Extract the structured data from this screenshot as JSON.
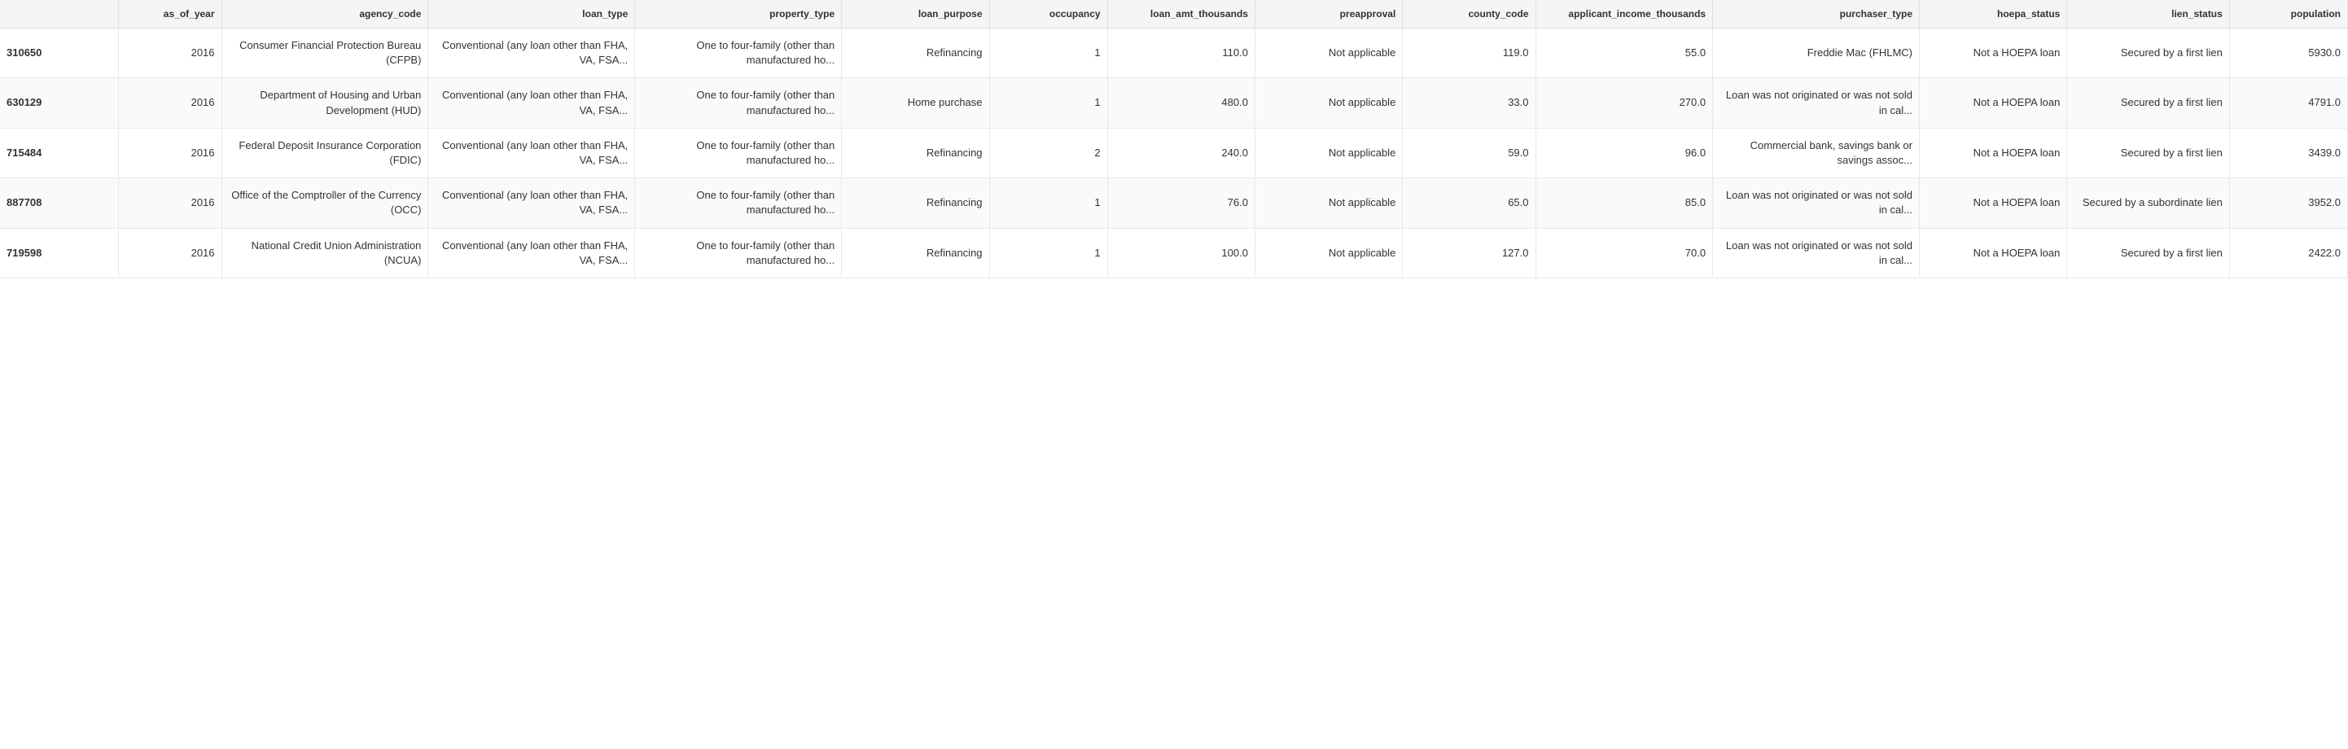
{
  "table": {
    "columns": [
      {
        "key": "id",
        "label": "",
        "class": "col-id"
      },
      {
        "key": "as_of_year",
        "label": "as_of_year",
        "class": "col-year"
      },
      {
        "key": "agency_code",
        "label": "agency_code",
        "class": "col-agency"
      },
      {
        "key": "loan_type",
        "label": "loan_type",
        "class": "col-loan-type"
      },
      {
        "key": "property_type",
        "label": "property_type",
        "class": "col-property"
      },
      {
        "key": "loan_purpose",
        "label": "loan_purpose",
        "class": "col-purpose"
      },
      {
        "key": "occupancy",
        "label": "occupancy",
        "class": "col-occupancy"
      },
      {
        "key": "loan_amt_thousands",
        "label": "loan_amt_thousands",
        "class": "col-amt"
      },
      {
        "key": "preapproval",
        "label": "preapproval",
        "class": "col-preapproval"
      },
      {
        "key": "county_code",
        "label": "county_code",
        "class": "col-county"
      },
      {
        "key": "applicant_income_thousands",
        "label": "applicant_income_thousands",
        "class": "col-income"
      },
      {
        "key": "purchaser_type",
        "label": "purchaser_type",
        "class": "col-purchaser"
      },
      {
        "key": "hoepa_status",
        "label": "hoepa_status",
        "class": "col-hoepa"
      },
      {
        "key": "lien_status",
        "label": "lien_status",
        "class": "col-lien"
      },
      {
        "key": "population",
        "label": "population",
        "class": "col-population"
      }
    ],
    "rows": [
      {
        "id": "310650",
        "as_of_year": "2016",
        "agency_code": "Consumer Financial Protection Bureau (CFPB)",
        "loan_type": "Conventional (any loan other than FHA, VA, FSA...",
        "property_type": "One to four-family (other than manufactured ho...",
        "loan_purpose": "Refinancing",
        "occupancy": "1",
        "loan_amt_thousands": "110.0",
        "preapproval": "Not applicable",
        "county_code": "119.0",
        "applicant_income_thousands": "55.0",
        "purchaser_type": "Freddie Mac (FHLMC)",
        "hoepa_status": "Not a HOEPA loan",
        "lien_status": "Secured by a first lien",
        "population": "5930.0"
      },
      {
        "id": "630129",
        "as_of_year": "2016",
        "agency_code": "Department of Housing and Urban Development (HUD)",
        "loan_type": "Conventional (any loan other than FHA, VA, FSA...",
        "property_type": "One to four-family (other than manufactured ho...",
        "loan_purpose": "Home purchase",
        "occupancy": "1",
        "loan_amt_thousands": "480.0",
        "preapproval": "Not applicable",
        "county_code": "33.0",
        "applicant_income_thousands": "270.0",
        "purchaser_type": "Loan was not originated or was not sold in cal...",
        "hoepa_status": "Not a HOEPA loan",
        "lien_status": "Secured by a first lien",
        "population": "4791.0"
      },
      {
        "id": "715484",
        "as_of_year": "2016",
        "agency_code": "Federal Deposit Insurance Corporation (FDIC)",
        "loan_type": "Conventional (any loan other than FHA, VA, FSA...",
        "property_type": "One to four-family (other than manufactured ho...",
        "loan_purpose": "Refinancing",
        "occupancy": "2",
        "loan_amt_thousands": "240.0",
        "preapproval": "Not applicable",
        "county_code": "59.0",
        "applicant_income_thousands": "96.0",
        "purchaser_type": "Commercial bank, savings bank or savings assoc...",
        "hoepa_status": "Not a HOEPA loan",
        "lien_status": "Secured by a first lien",
        "population": "3439.0"
      },
      {
        "id": "887708",
        "as_of_year": "2016",
        "agency_code": "Office of the Comptroller of the Currency (OCC)",
        "loan_type": "Conventional (any loan other than FHA, VA, FSA...",
        "property_type": "One to four-family (other than manufactured ho...",
        "loan_purpose": "Refinancing",
        "occupancy": "1",
        "loan_amt_thousands": "76.0",
        "preapproval": "Not applicable",
        "county_code": "65.0",
        "applicant_income_thousands": "85.0",
        "purchaser_type": "Loan was not originated or was not sold in cal...",
        "hoepa_status": "Not a HOEPA loan",
        "lien_status": "Secured by a subordinate lien",
        "population": "3952.0"
      },
      {
        "id": "719598",
        "as_of_year": "2016",
        "agency_code": "National Credit Union Administration (NCUA)",
        "loan_type": "Conventional (any loan other than FHA, VA, FSA...",
        "property_type": "One to four-family (other than manufactured ho...",
        "loan_purpose": "Refinancing",
        "occupancy": "1",
        "loan_amt_thousands": "100.0",
        "preapproval": "Not applicable",
        "county_code": "127.0",
        "applicant_income_thousands": "70.0",
        "purchaser_type": "Loan was not originated or was not sold in cal...",
        "hoepa_status": "Not a HOEPA loan",
        "lien_status": "Secured by a first lien",
        "population": "2422.0"
      }
    ]
  }
}
